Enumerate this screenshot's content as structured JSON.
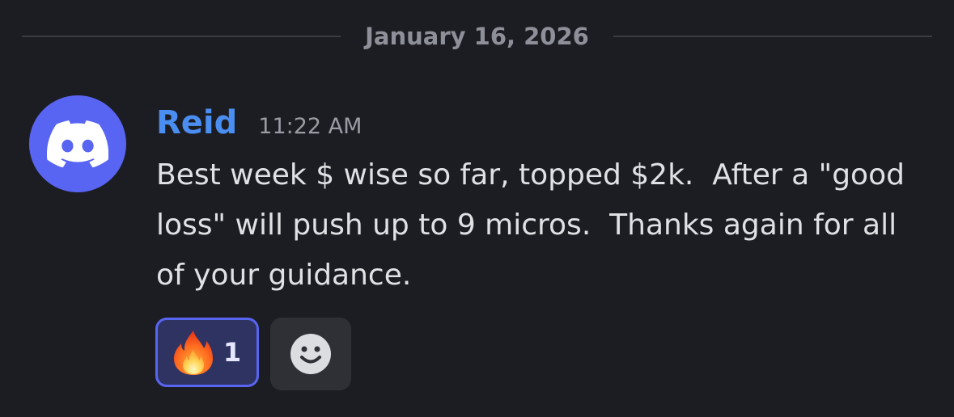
{
  "divider": {
    "date": "January 16, 2026"
  },
  "message": {
    "author": "Reid",
    "timestamp": "11:22 AM",
    "content": "Best week $ wise so far, topped $2k.  After a \"good loss\" will push up to 9 micros.  Thanks again for all of your guidance.",
    "avatar_icon": "discord-logo-icon",
    "avatar_color": "#5865f2",
    "author_color": "#4b8ef2"
  },
  "reactions": [
    {
      "emoji": "fire-icon",
      "count": "1",
      "selected": true
    }
  ],
  "add_reaction": {
    "icon": "smiley-icon"
  }
}
